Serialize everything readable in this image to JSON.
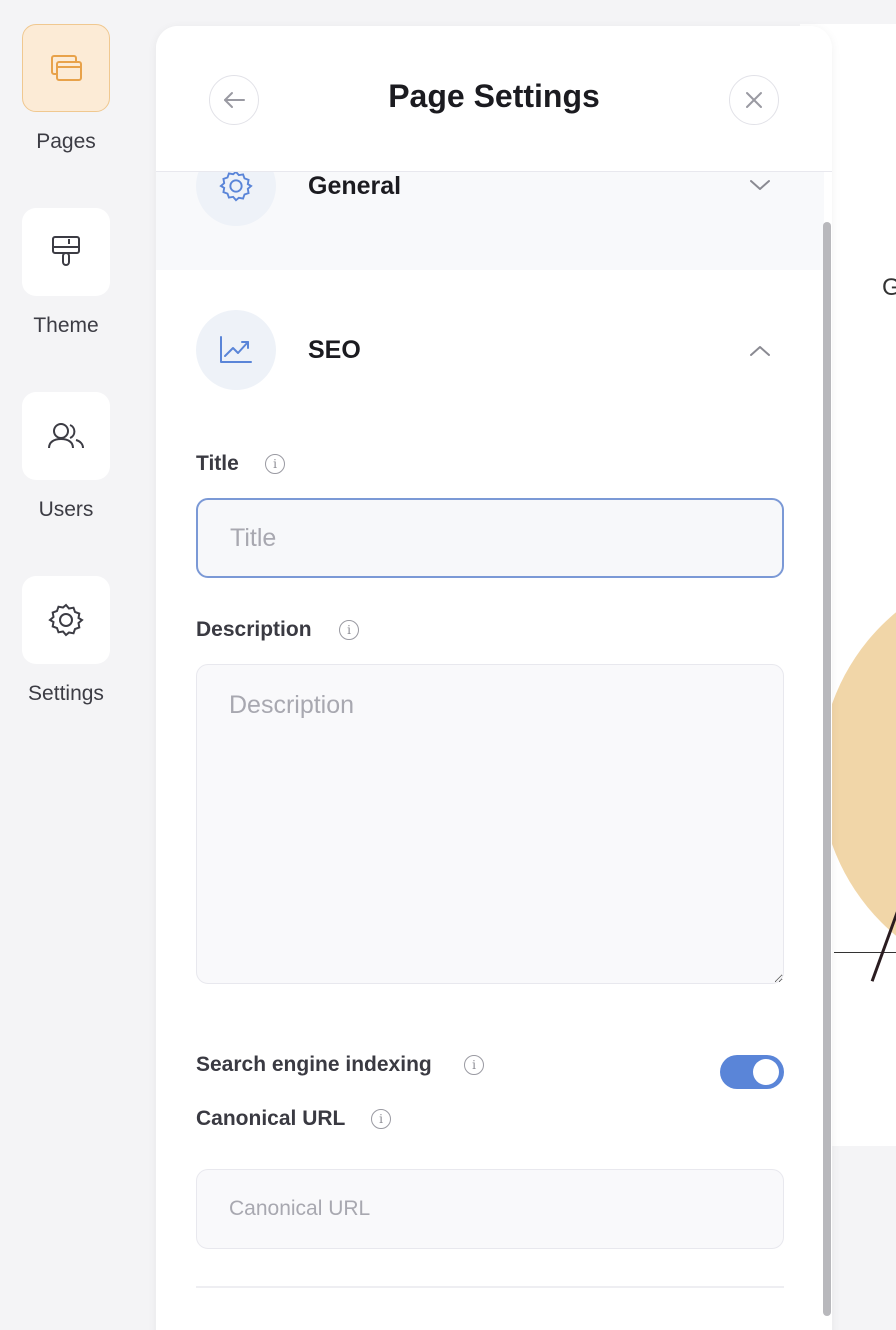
{
  "sidebar": {
    "items": [
      {
        "label": "Pages",
        "icon": "pages-icon",
        "active": true
      },
      {
        "label": "Theme",
        "icon": "paint-roller-icon",
        "active": false
      },
      {
        "label": "Users",
        "icon": "users-icon",
        "active": false
      },
      {
        "label": "Settings",
        "icon": "gear-icon",
        "active": false
      }
    ]
  },
  "panel": {
    "title": "Page Settings",
    "sections": {
      "general": {
        "title": "General",
        "expanded": false
      },
      "seo": {
        "title": "SEO",
        "expanded": true
      }
    },
    "fields": {
      "title": {
        "label": "Title",
        "placeholder": "Title",
        "value": ""
      },
      "description": {
        "label": "Description",
        "placeholder": "Description",
        "value": ""
      },
      "indexing": {
        "label": "Search engine indexing",
        "enabled": true
      },
      "canonical": {
        "label": "Canonical URL",
        "placeholder": "Canonical URL",
        "value": ""
      }
    }
  },
  "canvas": {
    "partial_text": "G"
  },
  "colors": {
    "accent": "#5a85d8",
    "active_nav_bg": "#fcebd6",
    "active_nav_border": "#f0c890",
    "icon_blue": "#5a85d8"
  }
}
